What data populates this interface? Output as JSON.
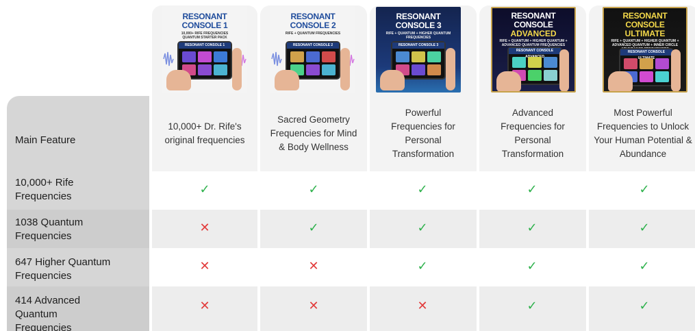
{
  "products": [
    {
      "title": "RESONANT CONSOLE 1",
      "title2": "",
      "subtitle": "10,000+ RIFE FREQUENCIES\nQUANTUM STARTER PACK",
      "screen": "RESONANT CONSOLE 1"
    },
    {
      "title": "RESONANT CONSOLE 2",
      "title2": "",
      "subtitle": "RIFE + QUANTUM FREQUENCIES",
      "screen": "RESONANT CONSOLE 2"
    },
    {
      "title": "RESONANT CONSOLE 3",
      "title2": "",
      "subtitle": "RIFE + QUANTUM + HIGHER QUANTUM FREQUENCIES",
      "screen": "RESONANT CONSOLE 3"
    },
    {
      "title": "RESONANT CONSOLE",
      "title2": "ADVANCED",
      "subtitle": "RIFE + QUANTUM + HIGHER QUANTUM + ADVANCED QUANTUM FREQUENCIES",
      "screen": "RESONANT CONSOLE ADVANCED"
    },
    {
      "title": "RESONANT CONSOLE",
      "title2": "ULTIMATE",
      "subtitle": "RIFE + QUANTUM + HIGHER QUANTUM + ADVANCED QUANTUM + INNER CIRCLE ABUNDANCE FREQUENCIES",
      "screen": "RESONANT CONSOLE ULTIMATE"
    }
  ],
  "feature_label": "Main Feature",
  "features": [
    "10,000+ Dr. Rife's original frequencies",
    "Sacred Geometry Frequencies for Mind & Body Wellness",
    "Powerful Frequencies for Personal Transformation",
    "Advanced Frequencies for Personal Transformation",
    "Most Powerful Frequencies to Unlock Your Human Potential & Abundance"
  ],
  "rows": [
    {
      "label": "10,000+ Rife Frequencies",
      "values": [
        true,
        true,
        true,
        true,
        true
      ]
    },
    {
      "label": "1038 Quantum Frequencies",
      "values": [
        false,
        true,
        true,
        true,
        true
      ]
    },
    {
      "label": "647 Higher Quantum Frequencies",
      "values": [
        false,
        false,
        true,
        true,
        true
      ]
    },
    {
      "label": "414 Advanced Quantum Frequencies",
      "values": [
        false,
        false,
        false,
        true,
        true
      ]
    }
  ],
  "symbols": {
    "check": "✓",
    "cross": "✕"
  },
  "colors": {
    "check": "#2db14b",
    "cross": "#e23b3b",
    "title_blue": "#1f4c9c",
    "gold": "#f4d94a"
  }
}
